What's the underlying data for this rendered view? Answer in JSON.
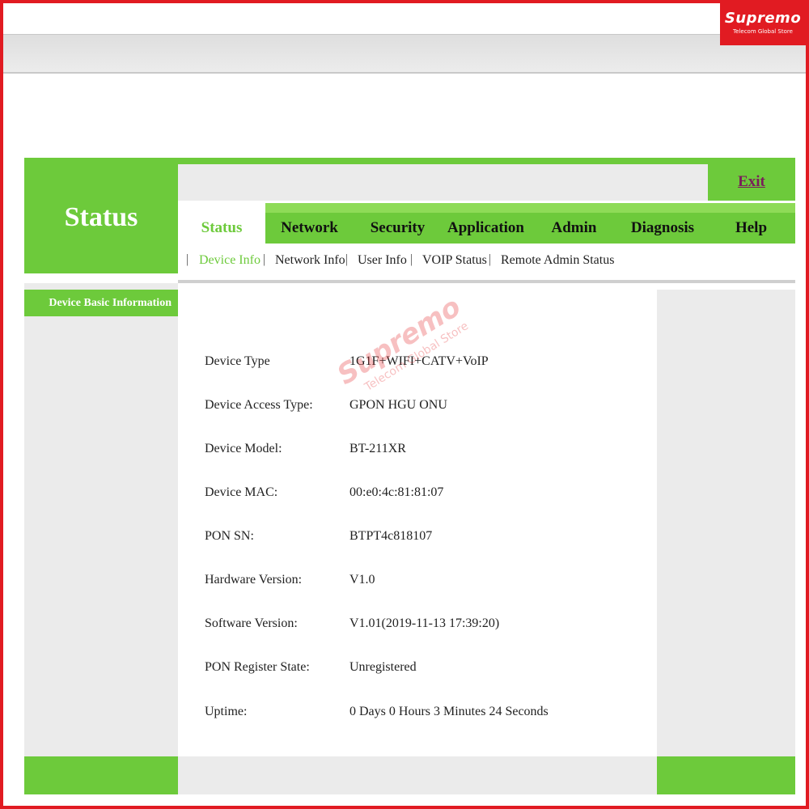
{
  "brand": {
    "name": "Supremo",
    "subtitle": "Telecom Global Store",
    "color": "#e11b22"
  },
  "watermark": {
    "name": "Supremo",
    "subtitle": "Telecom Global Store"
  },
  "header": {
    "title": "Status",
    "exit_label": "Exit"
  },
  "nav": {
    "tabs": [
      "Status",
      "Network",
      "Security",
      "Application",
      "Admin",
      "Diagnosis",
      "Help"
    ],
    "active_tab": "Status"
  },
  "subnav": {
    "links": [
      "Device Info",
      "Network Info",
      "User Info",
      "VOIP Status",
      "Remote Admin Status"
    ],
    "active_link": "Device Info"
  },
  "sidebar": {
    "items": [
      {
        "label": "Device Basic Information",
        "active": true
      }
    ]
  },
  "device_info": {
    "rows": [
      {
        "label": "Device Type",
        "value": "1G1F+WIFI+CATV+VoIP"
      },
      {
        "label": "Device Access Type:",
        "value": "GPON HGU ONU"
      },
      {
        "label": "Device Model:",
        "value": "BT-211XR"
      },
      {
        "label": "Device MAC:",
        "value": "00:e0:4c:81:81:07"
      },
      {
        "label": "PON SN:",
        "value": "BTPT4c818107"
      },
      {
        "label": "Hardware Version:",
        "value": "V1.0"
      },
      {
        "label": "Software Version:",
        "value": "V1.01(2019-11-13 17:39:20)"
      },
      {
        "label": "PON Register State:",
        "value": "Unregistered"
      },
      {
        "label": "Uptime:",
        "value": "0 Days 0 Hours 3 Minutes 24 Seconds"
      }
    ]
  },
  "colors": {
    "accent_green": "#6dca3b",
    "panel_gray": "#ebebeb",
    "frame_red": "#e11b22"
  }
}
